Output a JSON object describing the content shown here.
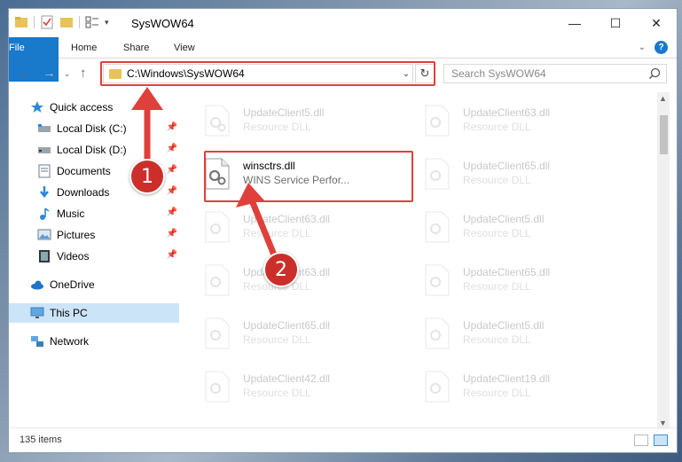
{
  "window": {
    "title": "SysWOW64",
    "controls": {
      "minimize": "—",
      "maximize": "☐",
      "close": "✕"
    }
  },
  "ribbon": {
    "tabs": [
      {
        "label": "File"
      },
      {
        "label": "Home"
      },
      {
        "label": "Share"
      },
      {
        "label": "View"
      }
    ]
  },
  "nav": {
    "path": "C:\\Windows\\SysWOW64",
    "search_placeholder": "Search SysWOW64"
  },
  "sidebar": {
    "items": [
      {
        "label": "Quick access",
        "icon": "star-icon",
        "pinned": false
      },
      {
        "label": "Local Disk (C:)",
        "icon": "drive-icon",
        "pinned": true
      },
      {
        "label": "Local Disk (D:)",
        "icon": "drive-icon",
        "pinned": true
      },
      {
        "label": "Documents",
        "icon": "documents-icon",
        "pinned": true
      },
      {
        "label": "Downloads",
        "icon": "downloads-icon",
        "pinned": true
      },
      {
        "label": "Music",
        "icon": "music-icon",
        "pinned": true
      },
      {
        "label": "Pictures",
        "icon": "pictures-icon",
        "pinned": true
      },
      {
        "label": "Videos",
        "icon": "videos-icon",
        "pinned": true
      },
      {
        "label": "OneDrive",
        "icon": "cloud-icon",
        "pinned": false
      },
      {
        "label": "This PC",
        "icon": "pc-icon",
        "pinned": false,
        "selected": true
      },
      {
        "label": "Network",
        "icon": "network-icon",
        "pinned": false
      }
    ]
  },
  "files": {
    "left_column": [
      {
        "name": "UpdateClient5.dll",
        "desc": "Resource DLL"
      },
      {
        "name": "winsctrs.dll",
        "desc": "WINS Service Perfor..."
      },
      {
        "name": "UpdateClient63.dll",
        "desc": "Resource DLL"
      },
      {
        "name": "UpdateClient63.dll",
        "desc": "Resource DLL"
      },
      {
        "name": "UpdateClient65.dll",
        "desc": "Resource DLL"
      },
      {
        "name": "UpdateClient42.dll",
        "desc": "Resource DLL"
      }
    ],
    "right_column": [
      {
        "name": "UpdateClient63.dll",
        "desc": "Resource DLL"
      },
      {
        "name": "UpdateClient65.dll",
        "desc": "Resource DLL"
      },
      {
        "name": "UpdateClient5.dll",
        "desc": "Resource DLL"
      },
      {
        "name": "UpdateClient65.dll",
        "desc": "Resource DLL"
      },
      {
        "name": "UpdateClient5.dll",
        "desc": "Resource DLL"
      },
      {
        "name": "UpdateClient19.dll",
        "desc": "Resource DLL"
      }
    ]
  },
  "status": {
    "count": "135 items"
  },
  "annotations": {
    "step1": "1",
    "step2": "2"
  },
  "colors": {
    "accent": "#1979ca",
    "highlight": "#e0403b",
    "badge": "#cc2f2a",
    "selected": "#cce4f7"
  }
}
